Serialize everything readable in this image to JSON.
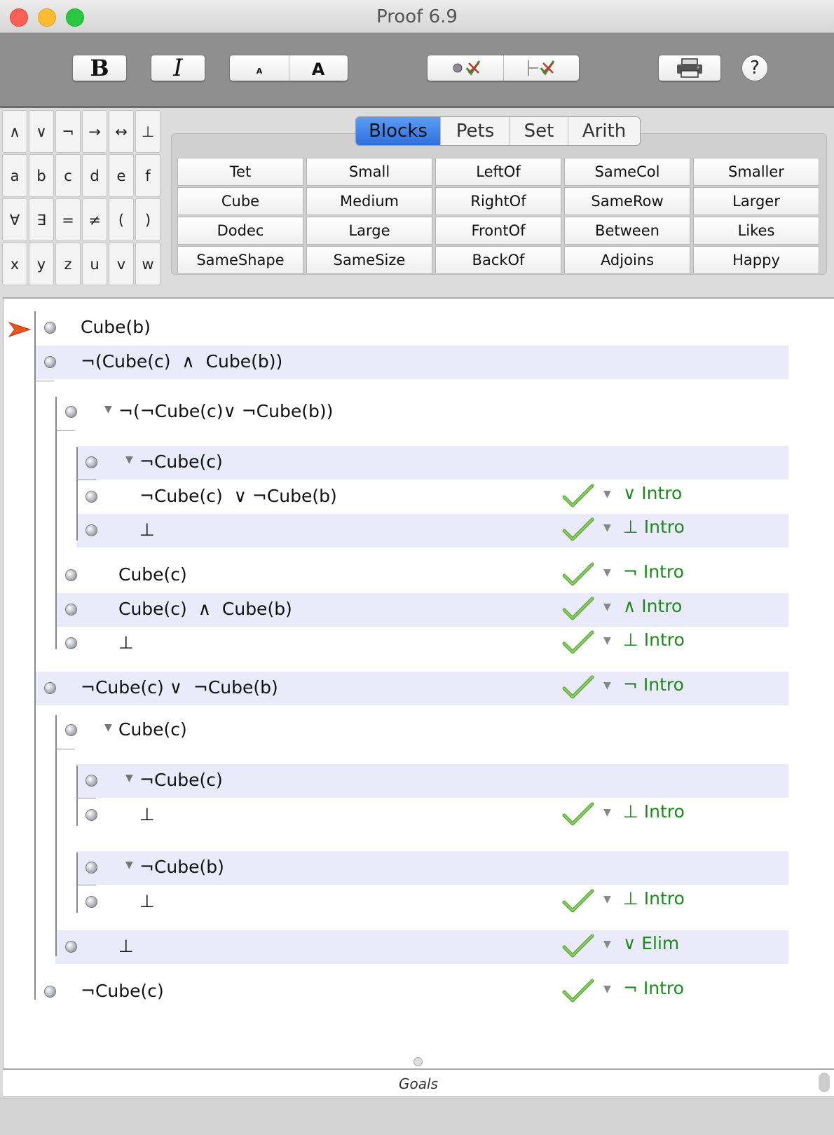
{
  "window": {
    "title": "Proof 6.9"
  },
  "toolbar": {
    "bold_label": "B",
    "italic_label": "I",
    "font_small_label": "A",
    "font_large_label": "A",
    "help_label": "?"
  },
  "palette": {
    "keys": [
      "∧",
      "∨",
      "¬",
      "→",
      "↔",
      "⊥",
      "a",
      "b",
      "c",
      "d",
      "e",
      "f",
      "∀",
      "∃",
      "=",
      "≠",
      "(",
      ")",
      "x",
      "y",
      "z",
      "u",
      "v",
      "w"
    ]
  },
  "tabs": [
    "Blocks",
    "Pets",
    "Set",
    "Arith"
  ],
  "predicates": [
    "Tet",
    "Small",
    "LeftOf",
    "SameCol",
    "Smaller",
    "Cube",
    "Medium",
    "RightOf",
    "SameRow",
    "Larger",
    "Dodec",
    "Large",
    "FrontOf",
    "Between",
    "Likes",
    "SameShape",
    "SameSize",
    "BackOf",
    "Adjoins",
    "Happy"
  ],
  "proof": {
    "steps": [
      {
        "text": "Cube(b)"
      },
      {
        "text": "¬(Cube(c)  ∧  Cube(b))"
      },
      {
        "text": "¬(¬Cube(c)∨ ¬Cube(b))"
      },
      {
        "text": "¬Cube(c)"
      },
      {
        "text": "¬Cube(c)  ∨ ¬Cube(b)",
        "rule": "∨ Intro"
      },
      {
        "text": "⊥",
        "rule": "⊥ Intro"
      },
      {
        "text": "Cube(c)",
        "rule": "¬ Intro"
      },
      {
        "text": "Cube(c)  ∧  Cube(b)",
        "rule": "∧ Intro"
      },
      {
        "text": "⊥",
        "rule": "⊥ Intro"
      },
      {
        "text": "¬Cube(c) ∨  ¬Cube(b)",
        "rule": "¬ Intro"
      },
      {
        "text": "Cube(c)"
      },
      {
        "text": "¬Cube(c)"
      },
      {
        "text": "⊥",
        "rule": "⊥ Intro"
      },
      {
        "text": "¬Cube(b)"
      },
      {
        "text": "⊥",
        "rule": "⊥ Intro"
      },
      {
        "text": "⊥",
        "rule": "∨ Elim"
      },
      {
        "text": "¬Cube(c)",
        "rule": "¬ Intro"
      }
    ]
  },
  "goals": {
    "label": "Goals"
  },
  "colors": {
    "accent_tab": "#2f6fe0",
    "rule_green": "#1d8a1d",
    "focus_arrow": "#e8531e",
    "row_highlight": "#eaeafa"
  }
}
